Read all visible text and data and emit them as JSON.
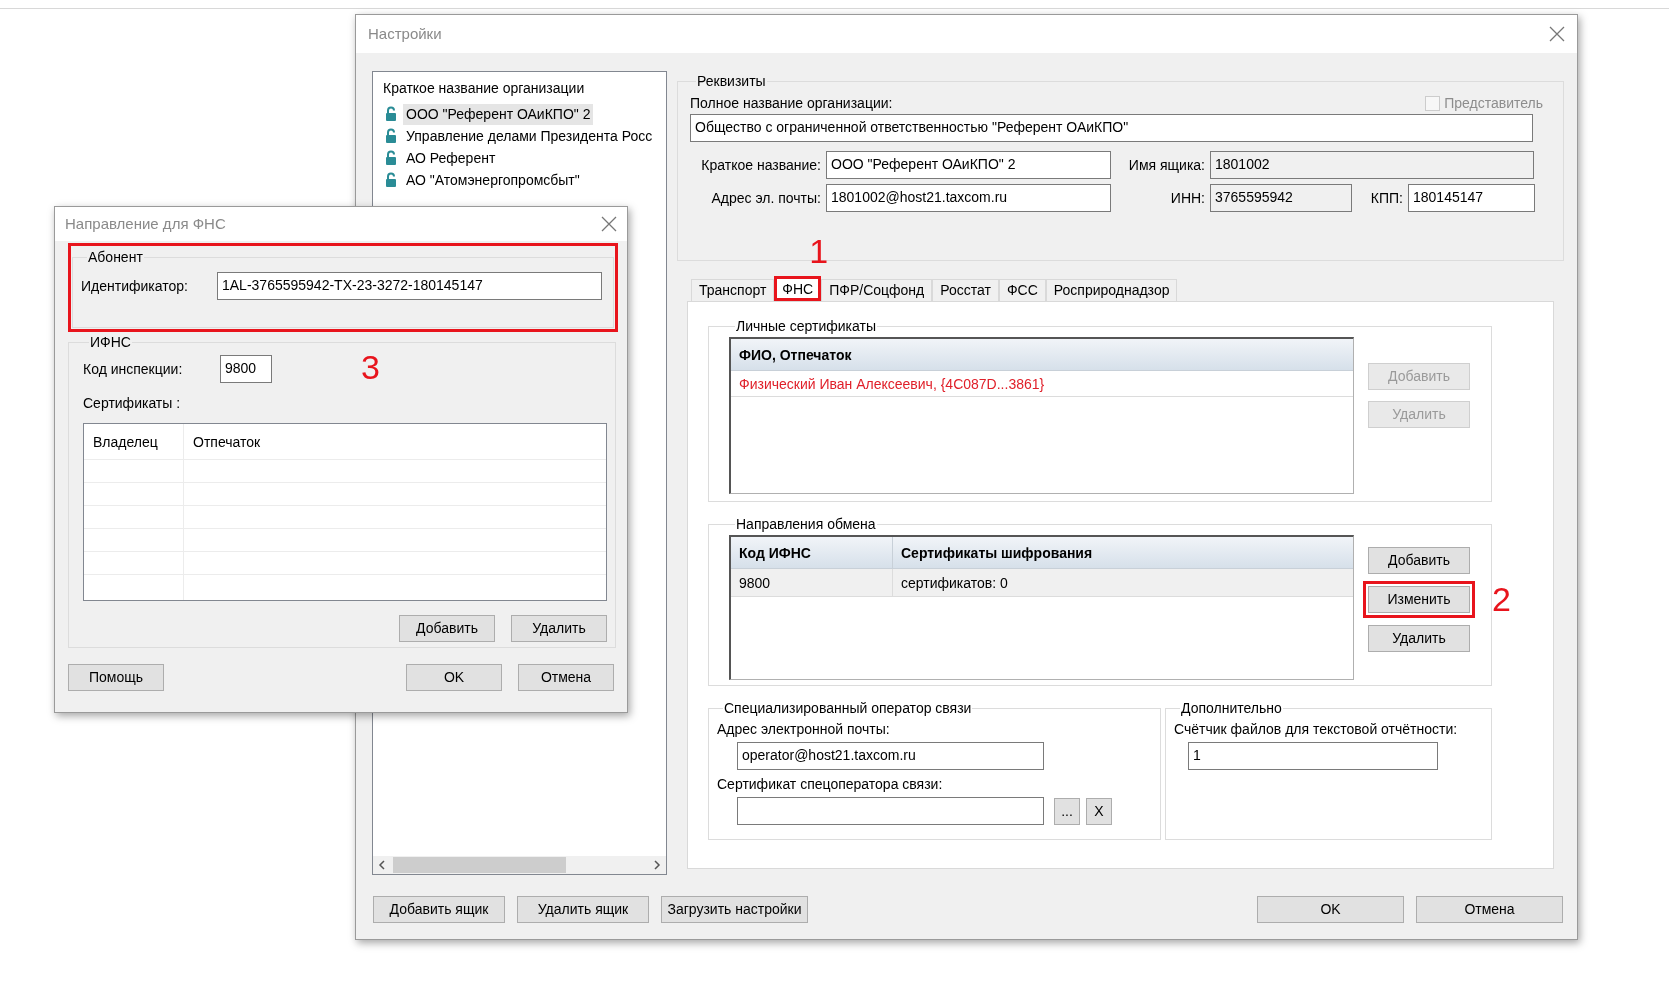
{
  "settings_window": {
    "title": "Настройки"
  },
  "org_list": {
    "header": "Краткое название организации",
    "items": [
      {
        "label": "ООО \"Референт ОАиКПО\" 2",
        "selected": true
      },
      {
        "label": "Управление делами Президента Росс",
        "selected": false
      },
      {
        "label": "АО Референт",
        "selected": false
      },
      {
        "label": "АО \"Атомэнергопромсбыт\"",
        "selected": false
      }
    ]
  },
  "requisites": {
    "title": "Реквизиты",
    "representative": {
      "label": "Представитель",
      "checked": false,
      "disabled": true
    },
    "full_name": {
      "label": "Полное название организации:",
      "value": "Общество с ограниченной ответственностью \"Референт ОАиКПО\""
    },
    "short_name": {
      "label": "Краткое название:",
      "value": "ООО \"Референт ОАиКПО\" 2"
    },
    "box_name": {
      "label": "Имя ящика:",
      "value": "1801002",
      "disabled": true
    },
    "email": {
      "label": "Адрес эл. почты:",
      "value": "1801002@host21.taxcom.ru"
    },
    "inn": {
      "label": "ИНН:",
      "value": "3765595942",
      "disabled": true
    },
    "kpp": {
      "label": "КПП:",
      "value": "180145147",
      "disabled": false
    }
  },
  "tabs": [
    {
      "label": "Транспорт",
      "selected": false
    },
    {
      "label": "ФНС",
      "selected": true,
      "annotation": "1"
    },
    {
      "label": "ПФР/Соцфонд",
      "selected": false
    },
    {
      "label": "Росстат",
      "selected": false
    },
    {
      "label": "ФСС",
      "selected": false
    },
    {
      "label": "Росприроднадзор",
      "selected": false
    }
  ],
  "personal_certificates": {
    "title": "Личные сертификаты",
    "column": "ФИО, Отпечаток",
    "rows": [
      {
        "text": "Физический Иван Алексеевич, {4C087D...3861}",
        "invalid": true
      }
    ],
    "buttons": [
      {
        "label": "Добавить",
        "disabled": true
      },
      {
        "label": "Удалить",
        "disabled": true
      }
    ]
  },
  "exchange_directions": {
    "title": "Направления обмена",
    "columns": [
      "Код ИФНС",
      "Сертификаты шифрования"
    ],
    "rows": [
      [
        "9800",
        "сертификатов: 0"
      ]
    ],
    "buttons": [
      {
        "label": "Добавить",
        "disabled": false
      },
      {
        "label": "Изменить",
        "disabled": false,
        "annotation": "2"
      },
      {
        "label": "Удалить",
        "disabled": false
      }
    ]
  },
  "operator": {
    "title": "Специализированный оператор связи",
    "email_label": "Адрес электронной почты:",
    "email": "operator@host21.taxcom.ru",
    "cert_label": "Сертификат спецоператора связи:",
    "browse_button": "...",
    "clear_button": "X"
  },
  "additional": {
    "title": "Дополнительно",
    "counter_label": "Счётчик файлов для текстовой отчётности:",
    "counter": "1"
  },
  "footer_left": [
    "Добавить ящик",
    "Удалить ящик",
    "Загрузить настройки"
  ],
  "footer_right": [
    "OK",
    "Отмена"
  ],
  "dialog": {
    "title": "Направление для ФНС",
    "subscriber": {
      "title": "Абонент",
      "label": "Идентификатор:",
      "value": "1AL-3765595942-TX-23-3272-180145147",
      "annotation": "3"
    },
    "ifns": {
      "title": "ИФНС",
      "code_label": "Код инспекции:",
      "code": "9800",
      "certs_label": "Сертификаты :",
      "columns": [
        "Владелец",
        "Отпечаток"
      ],
      "buttons": [
        "Добавить",
        "Удалить"
      ]
    },
    "help_button": "Помощь",
    "buttons": [
      "OK",
      "Отмена"
    ]
  }
}
